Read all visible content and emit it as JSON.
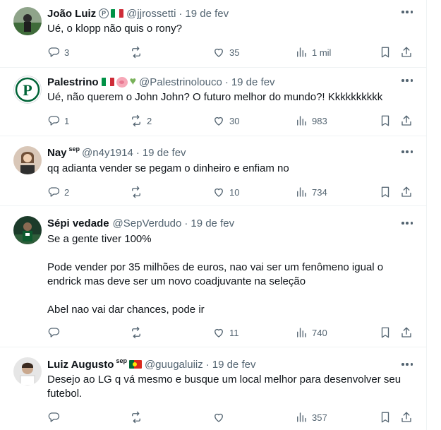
{
  "tweets": [
    {
      "name": "João Luiz",
      "handle": "@jjrossetti",
      "time": "19 de fev",
      "text": "Ué, o klopp não quis o rony?",
      "replies": "3",
      "retweets": "",
      "likes": "35",
      "views": "1 mil",
      "badges": [
        "p-icon",
        "italy-flag"
      ]
    },
    {
      "name": "Palestrino",
      "handle": "@Palestrinolouco",
      "time": "19 de fev",
      "text": "Ué, não querem o John John? O futuro melhor do mundo?! Kkkkkkkkkk",
      "replies": "1",
      "retweets": "2",
      "likes": "30",
      "views": "983",
      "badges": [
        "italy-flag",
        "pig-icon",
        "green-heart-icon"
      ]
    },
    {
      "name": "Nay",
      "name_tag": "sep",
      "handle": "@n4y1914",
      "time": "19 de fev",
      "text": "qq adianta vender se pegam o dinheiro e enfiam no",
      "replies": "2",
      "retweets": "",
      "likes": "10",
      "views": "734"
    },
    {
      "name": "Sépi vedade",
      "handle": "@SepVerdudo",
      "time": "19 de fev",
      "text": "Se a gente tiver 100%\n\nPode vender por 35 milhões de euros, nao vai ser um fenômeno igual o endrick mas deve ser um novo coadjuvante na seleção\n\nAbel nao vai dar chances, pode ir",
      "replies": "",
      "retweets": "",
      "likes": "11",
      "views": "740"
    },
    {
      "name": "Luiz Augusto",
      "name_tag": "sep",
      "handle": "@guugaluiiz",
      "time": "19 de fev",
      "text": "Desejo ao LG q vá mesmo e busque um local melhor para desenvolver seu futebol.",
      "replies": "",
      "retweets": "",
      "likes": "",
      "views": "357",
      "badges": [
        "portugal-flag"
      ]
    }
  ],
  "colors": {
    "text": "#0f1419",
    "secondary": "#536471",
    "divider": "#eff3f4",
    "palmeiras_green": "#006437"
  },
  "icons": [
    "reply-icon",
    "retweet-icon",
    "like-icon",
    "views-icon",
    "bookmark-icon",
    "share-icon",
    "more-icon"
  ]
}
